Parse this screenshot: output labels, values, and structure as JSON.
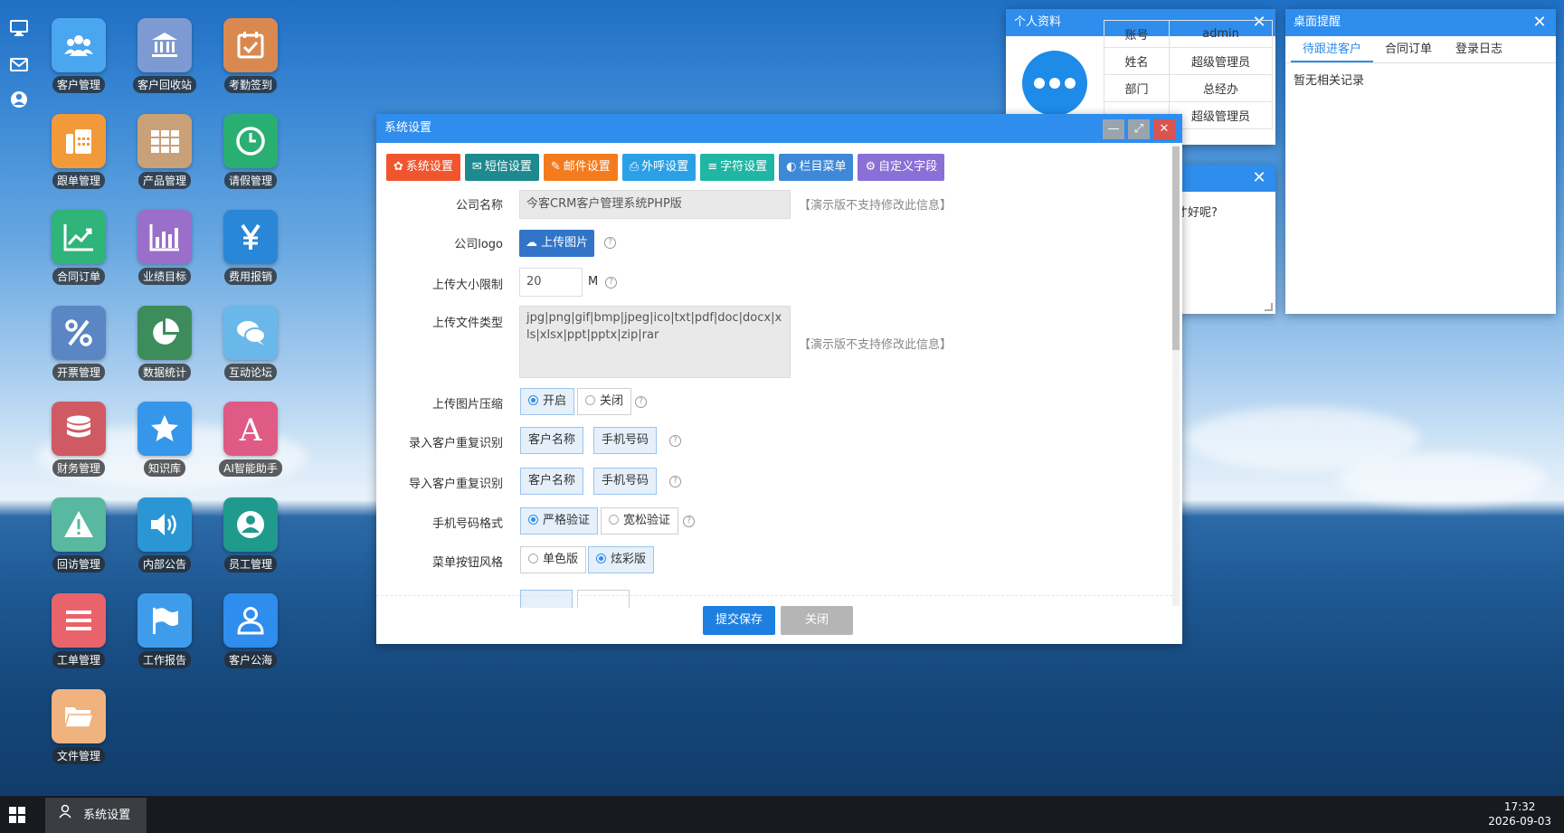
{
  "desktop": {
    "icons": [
      {
        "label": "客户管理",
        "icon": "users-icon",
        "color": "#4aa6ef"
      },
      {
        "label": "客户回收站",
        "icon": "bank-icon",
        "color": "#7d9bd2"
      },
      {
        "label": "考勤签到",
        "icon": "calendar-check-icon",
        "color": "#d9894f"
      },
      {
        "label": "跟单管理",
        "icon": "phone-fax-icon",
        "color": "#f29a3a"
      },
      {
        "label": "产品管理",
        "icon": "grid-icon",
        "color": "#c9a178"
      },
      {
        "label": "请假管理",
        "icon": "clock-icon",
        "color": "#2aaf72"
      },
      {
        "label": "合同订单",
        "icon": "line-chart-icon",
        "color": "#2fb47a"
      },
      {
        "label": "业绩目标",
        "icon": "bar-chart-icon",
        "color": "#9a6fc9"
      },
      {
        "label": "费用报销",
        "icon": "yen-icon",
        "color": "#2a86d6"
      },
      {
        "label": "开票管理",
        "icon": "percent-icon",
        "color": "#5a86c4"
      },
      {
        "label": "数据统计",
        "icon": "pie-chart-icon",
        "color": "#3d8d5c"
      },
      {
        "label": "互动论坛",
        "icon": "chat-icon",
        "color": "#6ab8ea"
      },
      {
        "label": "财务管理",
        "icon": "database-icon",
        "color": "#d05a63"
      },
      {
        "label": "知识库",
        "icon": "star-icon",
        "color": "#3596ea"
      },
      {
        "label": "AI智能助手",
        "icon": "letter-a-icon",
        "color": "#e05a86"
      },
      {
        "label": "回访管理",
        "icon": "warning-icon",
        "color": "#58b8a0"
      },
      {
        "label": "内部公告",
        "icon": "speaker-icon",
        "color": "#2a97d4"
      },
      {
        "label": "员工管理",
        "icon": "user-circle-icon",
        "color": "#1f9a8d"
      },
      {
        "label": "工单管理",
        "icon": "list-icon",
        "color": "#e8646a"
      },
      {
        "label": "工作报告",
        "icon": "flag-icon",
        "color": "#3f9ceb"
      },
      {
        "label": "客户公海",
        "icon": "user-icon",
        "color": "#2e8ded"
      },
      {
        "label": "文件管理",
        "icon": "folder-icon",
        "color": "#f0b27e"
      }
    ]
  },
  "profile_window": {
    "title": "个人资料",
    "rows": [
      [
        "账号",
        "admin"
      ],
      [
        "姓名",
        "超级管理员"
      ],
      [
        "部门",
        "总经办"
      ],
      [
        "",
        "超级管理员"
      ]
    ]
  },
  "note_window": {
    "text": "才好呢?"
  },
  "reminder_window": {
    "title": "桌面提醒",
    "tabs": [
      "待跟进客户",
      "合同订单",
      "登录日志"
    ],
    "empty_text": "暂无相关记录"
  },
  "settings_window": {
    "title": "系统设置",
    "tabs": [
      {
        "label": "系统设置",
        "icon": "gear-icon",
        "color": "#f1552d"
      },
      {
        "label": "短信设置",
        "icon": "envelope-icon",
        "color": "#1c8a8e"
      },
      {
        "label": "邮件设置",
        "icon": "edit-icon",
        "color": "#f37b1d"
      },
      {
        "label": "外呼设置",
        "icon": "printer-icon",
        "color": "#2aa1e6"
      },
      {
        "label": "字符设置",
        "icon": "bars-icon",
        "color": "#20b6a4"
      },
      {
        "label": "栏目菜单",
        "icon": "toggle-icon",
        "color": "#3e88d8"
      },
      {
        "label": "自定义字段",
        "icon": "cogs-icon",
        "color": "#8a6fd6"
      }
    ],
    "form": {
      "company_name": {
        "label": "公司名称",
        "value": "今客CRM客户管理系统PHP版",
        "tip": "【演示版不支持修改此信息】"
      },
      "company_logo": {
        "label": "公司logo",
        "button": "上传图片"
      },
      "upload_size": {
        "label": "上传大小限制",
        "value": "20",
        "unit": "M"
      },
      "file_types": {
        "label": "上传文件类型",
        "value": "jpg|png|gif|bmp|jpeg|ico|txt|pdf|doc|docx|xls|xlsx|ppt|pptx|zip|rar",
        "tip": "【演示版不支持修改此信息】"
      },
      "compress": {
        "label": "上传图片压缩",
        "options": [
          "开启",
          "关闭"
        ],
        "selected": "开启"
      },
      "dup_entry": {
        "label": "录入客户重复识别",
        "options": [
          "客户名称",
          "手机号码"
        ]
      },
      "dup_import": {
        "label": "导入客户重复识别",
        "options": [
          "客户名称",
          "手机号码"
        ]
      },
      "phone_format": {
        "label": "手机号码格式",
        "options": [
          "严格验证",
          "宽松验证"
        ],
        "selected": "严格验证"
      },
      "menu_style": {
        "label": "菜单按钮风格",
        "options": [
          "单色版",
          "炫彩版"
        ],
        "selected": "炫彩版"
      }
    },
    "buttons": {
      "submit": "提交保存",
      "close": "关闭"
    }
  },
  "taskbar": {
    "app": "系统设置",
    "time": "17:32",
    "date": "2026-09-03"
  }
}
